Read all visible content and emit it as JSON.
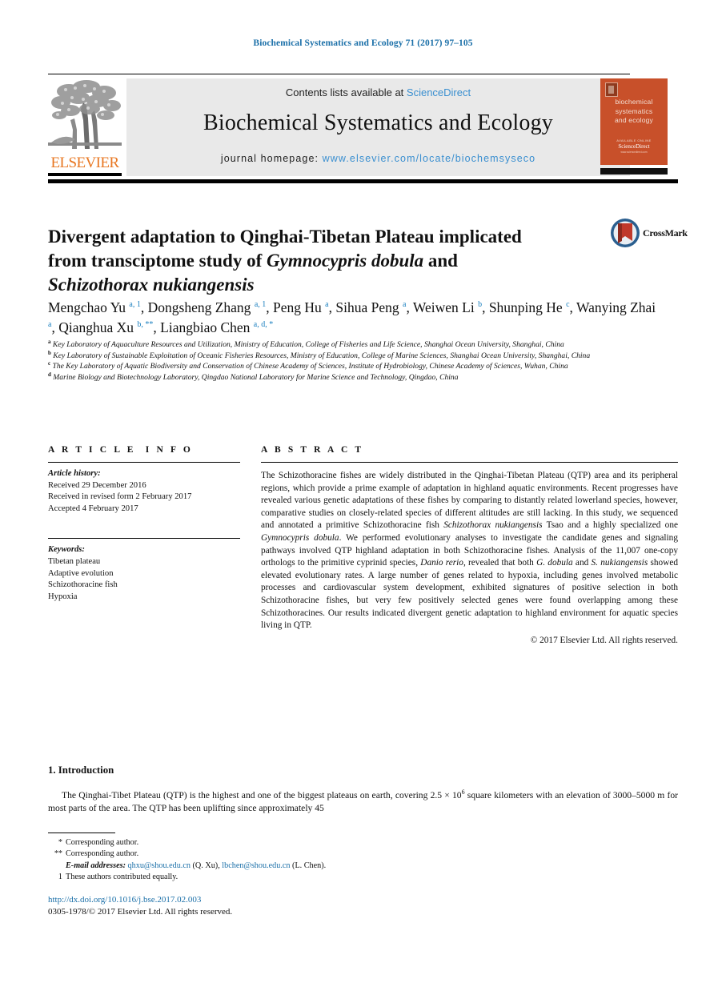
{
  "running_head": "Biochemical Systematics and Ecology 71 (2017) 97–105",
  "masthead": {
    "contents_prefix": "Contents lists available at ",
    "sciencedirect_link": "ScienceDirect",
    "journal_title": "Biochemical Systematics and Ecology",
    "homepage_label": "journal homepage: ",
    "homepage_url": "www.elsevier.com/locate/biochemsyseco",
    "publisher_logo_text": "ELSEVIER",
    "publisher_logo_icon": "elsevier-tree-icon"
  },
  "cover": {
    "line1": "biochemical",
    "line2": "systematics",
    "line3": "and ecology",
    "foot_small": "AVAILABLE ONLINE",
    "foot_brand": "ScienceDirect",
    "foot_url": "www.sciencedirect.com"
  },
  "crossmark": {
    "label": "CrossMark",
    "icon": "crossmark-icon"
  },
  "title": {
    "line1": "Divergent adaptation to Qinghai-Tibetan Plateau implicated",
    "line2_plain": "from transciptome study of ",
    "line2_italic": "Gymnocypris dobula",
    "line2_tail": " and",
    "line3_italic": "Schizothorax nukiangensis"
  },
  "authors": [
    {
      "name": "Mengchao Yu",
      "sup": "a, 1",
      "sep": ", "
    },
    {
      "name": "Dongsheng Zhang",
      "sup": "a, 1",
      "sep": ", "
    },
    {
      "name": "Peng Hu",
      "sup": "a",
      "sep": ", "
    },
    {
      "name": "Sihua Peng",
      "sup": "a",
      "sep": ", "
    },
    {
      "name": "Weiwen Li",
      "sup": "b",
      "sep": ", "
    },
    {
      "name": "Shunping He",
      "sup": "c",
      "sep": ", "
    },
    {
      "name": "Wanying Zhai",
      "sup": "a",
      "sep": ", "
    },
    {
      "name": "Qianghua Xu",
      "sup": "b, **",
      "sep": ", "
    },
    {
      "name": "Liangbiao Chen",
      "sup": "a, d, *",
      "sep": ""
    }
  ],
  "affiliations": [
    {
      "marker": "a",
      "text": "Key Laboratory of Aquaculture Resources and Utilization, Ministry of Education, College of Fisheries and Life Science, Shanghai Ocean University, Shanghai, China"
    },
    {
      "marker": "b",
      "text": "Key Laboratory of Sustainable Exploitation of Oceanic Fisheries Resources, Ministry of Education, College of Marine Sciences, Shanghai Ocean University, Shanghai, China"
    },
    {
      "marker": "c",
      "text": "The Key Laboratory of Aquatic Biodiversity and Conservation of Chinese Academy of Sciences, Institute of Hydrobiology, Chinese Academy of Sciences, Wuhan, China"
    },
    {
      "marker": "d",
      "text": "Marine Biology and Biotechnology Laboratory, Qingdao National Laboratory for Marine Science and Technology, Qingdao, China"
    }
  ],
  "article_info": {
    "heading": "ARTICLE INFO",
    "history_label": "Article history:",
    "history": [
      "Received 29 December 2016",
      "Received in revised form 2 February 2017",
      "Accepted 4 February 2017"
    ],
    "keywords_label": "Keywords:",
    "keywords": [
      "Tibetan plateau",
      "Adaptive evolution",
      "Schizothoracine fish",
      "Hypoxia"
    ]
  },
  "abstract": {
    "heading": "ABSTRACT",
    "p1": "The Schizothoracine fishes are widely distributed in the Qinghai-Tibetan Plateau (QTP) area and its peripheral regions, which provide a prime example of adaptation in highland aquatic environments. Recent progresses have revealed various genetic adaptations of these fishes by comparing to distantly related lowerland species, however, comparative studies on closely-related species of different altitudes are still lacking. In this study, we sequenced and annotated a primitive Schizothoracine fish ",
    "i1": "Schizothorax nukiangensis",
    "p2": " Tsao and a highly specialized one ",
    "i2": "Gymnocypris dobula",
    "p3": ". We performed evolutionary analyses to investigate the candidate genes and signaling pathways involved QTP highland adaptation in both Schizothoracine fishes. Analysis of the 11,007 one-copy orthologs to the primitive cyprinid species, ",
    "i3": "Danio rerio",
    "p4": ", revealed that both ",
    "i4": "G. dobula",
    "p5": " and ",
    "i5": "S. nukiangensis",
    "p6": " showed elevated evolutionary rates. A large number of genes related to hypoxia, including genes involved metabolic processes and cardiovascular system development, exhibited signatures of positive selection in both Schizothoracine fishes, but very few positively selected genes were found overlapping among these Schizothoracines. Our results indicated divergent genetic adaptation to highland environment for aquatic species living in QTP.",
    "copyright": "© 2017 Elsevier Ltd. All rights reserved."
  },
  "introduction": {
    "heading": "1. Introduction",
    "para_a": "The Qinghai-Tibet Plateau (QTP) is the highest and one of the biggest plateaus on earth, covering 2.5 × 10",
    "exponent": "6",
    "para_b": " square kilometers with an elevation of 3000–5000 m for most parts of the area. The QTP has been uplifting since approximately 45"
  },
  "footnotes": {
    "corr1_marker": "*",
    "corr1_text": "Corresponding author.",
    "corr2_marker": "**",
    "corr2_text": "Corresponding author.",
    "email_label": "E-mail addresses:",
    "email1": "qhxu@shou.edu.cn",
    "email1_owner": " (Q. Xu), ",
    "email2": "lbchen@shou.edu.cn",
    "email2_owner": " (L. Chen).",
    "equal_marker": "1",
    "equal_text": "These authors contributed equally.",
    "doi": "http://dx.doi.org/10.1016/j.bse.2017.02.003",
    "issn": "0305-1978/© 2017 Elsevier Ltd. All rights reserved."
  }
}
